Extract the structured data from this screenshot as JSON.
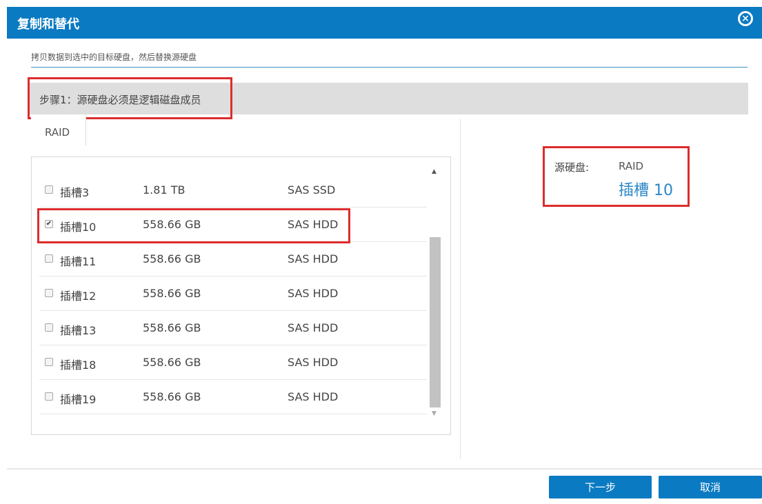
{
  "dialog": {
    "title": "复制和替代",
    "close_icon": "close-circle-icon",
    "subtitle": "拷贝数据到选中的目标硬盘，然后替换源硬盘"
  },
  "step": {
    "text": "步骤1：源硬盘必须是逻辑磁盘成员"
  },
  "tabs": [
    {
      "label": "RAID"
    }
  ],
  "disk_list": {
    "rows": [
      {
        "slot": "插槽3",
        "size": "1.81 TB",
        "type": "SAS SSD",
        "checked": false
      },
      {
        "slot": "插槽10",
        "size": "558.66 GB",
        "type": "SAS HDD",
        "checked": true
      },
      {
        "slot": "插槽11",
        "size": "558.66 GB",
        "type": "SAS HDD",
        "checked": false
      },
      {
        "slot": "插槽12",
        "size": "558.66 GB",
        "type": "SAS HDD",
        "checked": false
      },
      {
        "slot": "插槽13",
        "size": "558.66 GB",
        "type": "SAS HDD",
        "checked": false
      },
      {
        "slot": "插槽18",
        "size": "558.66 GB",
        "type": "SAS HDD",
        "checked": false
      },
      {
        "slot": "插槽19",
        "size": "558.66 GB",
        "type": "SAS HDD",
        "checked": false
      }
    ]
  },
  "source": {
    "label": "源硬盘:",
    "raid": "RAID",
    "slot": "插槽 10"
  },
  "buttons": {
    "next": "下一步",
    "cancel": "取消"
  },
  "colors": {
    "accent": "#0a7ac2",
    "highlight_border": "#dd2c2c",
    "link": "#2a86c8"
  }
}
